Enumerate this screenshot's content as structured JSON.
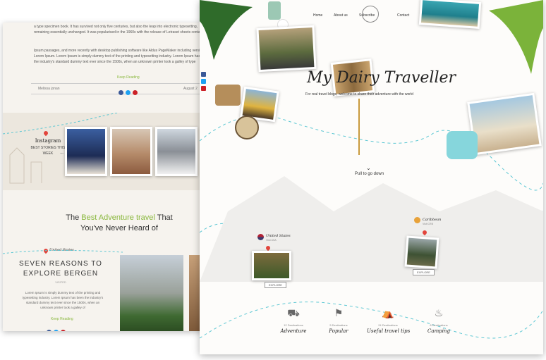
{
  "back": {
    "paragraph1": "a type specimen book. It has survived not only five centuries, but also the leap into electronic typesetting, remaining essentially unchanged. It was popularised in the 1960s with the release of Letraset sheets containing",
    "paragraph2": "Ipsum passages, and more recently with desktop publishing software like Aldus PageMaker including versions of Lorem Ipsum. Lorem Ipsum is simply dummy text of the printing and typesetting industry. Lorem Ipsum has been the industry's standard dummy text ever since the 1500s, when an unknown printer took a galley of type",
    "keep_reading": "Keep Reading",
    "author": "Melissa jonan",
    "date": "August 2",
    "instagram": {
      "title": "Instagram",
      "subtitle": "BEST STORIES THIS WEEK"
    },
    "heading": {
      "pre": "The",
      "highlight1": "Best Adventure",
      "highlight2": "travel",
      "post": "That",
      "line2": "You've Never Heard of"
    },
    "article": {
      "country": "United States",
      "title": "SEVEN REASONS TO EXPLORE BERGEN",
      "visitors": "VISITED",
      "excerpt": "Lorem Ipsum is simply dummy text of the printing and typesetting industry. Lorem Ipsum has been the industry's standard dummy text ever since the 1500s, when an unknown printer took a galley of",
      "keep_reading": "Keep Reading"
    }
  },
  "front": {
    "nav": [
      "Home",
      "About us",
      "Subscribe",
      "Contact"
    ],
    "logo_text": "",
    "title": "My Dairy Traveller",
    "subtitle": "For real travel blogs, welcome to share their adventure with the world",
    "pull_down": "Pull to go down",
    "map_points": [
      {
        "country": "United States",
        "sub": "Visit USA",
        "tag": "EXPLORE"
      },
      {
        "country": "Caribbean",
        "sub": "Visit CRB",
        "tag": "EXPLORE"
      }
    ],
    "categories": [
      {
        "label": "Adventure",
        "sub": "12 Destinations",
        "icon": "van-icon"
      },
      {
        "label": "Popular",
        "sub": "5 Destinations",
        "icon": "signpost-icon"
      },
      {
        "label": "Useful travel tips",
        "sub": "24 Destinations",
        "icon": "backpack-icon"
      },
      {
        "label": "Camping",
        "sub": "8 Destinations",
        "icon": "campfire-icon"
      }
    ]
  },
  "colors": {
    "accent_green": "#8ab83e",
    "dashed_route": "#5cc7d3",
    "pin_red": "#e2453c"
  }
}
